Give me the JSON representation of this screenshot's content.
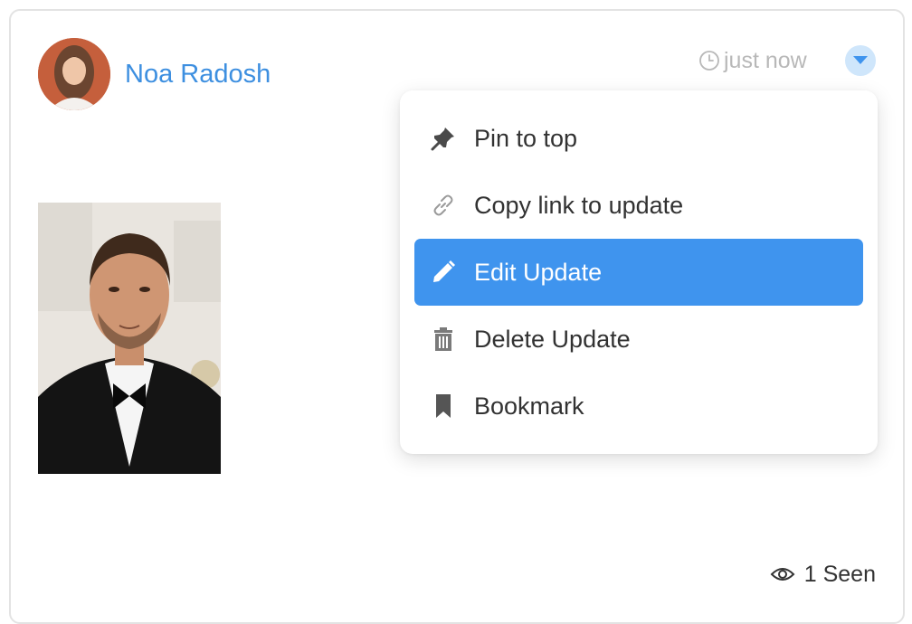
{
  "post": {
    "author": "Noa Radosh",
    "timestamp": "just now",
    "seen_count": "1 Seen"
  },
  "menu": {
    "items": [
      {
        "label": "Pin to top",
        "icon": "pin-icon"
      },
      {
        "label": "Copy link to update",
        "icon": "link-icon"
      },
      {
        "label": "Edit Update",
        "icon": "pencil-icon",
        "active": true
      },
      {
        "label": "Delete Update",
        "icon": "trash-icon"
      },
      {
        "label": "Bookmark",
        "icon": "bookmark-icon"
      }
    ]
  },
  "colors": {
    "accent": "#3f94ee",
    "author_link": "#3d8fe0",
    "muted_text": "#b8b8b8",
    "toggle_bg": "#cfe6fb"
  }
}
